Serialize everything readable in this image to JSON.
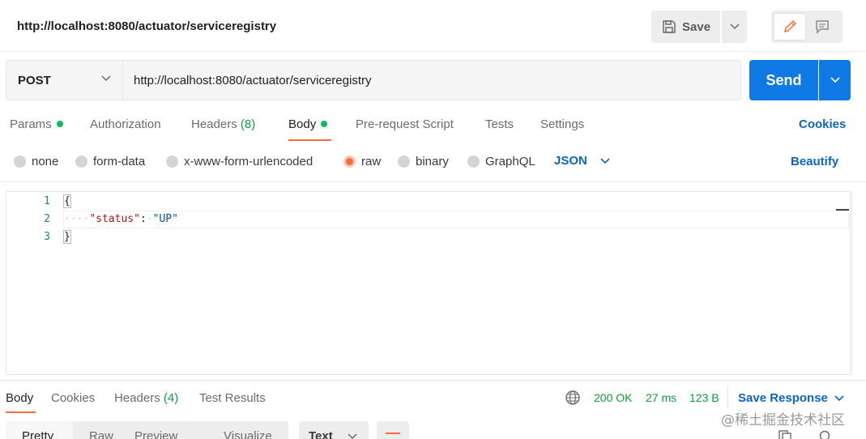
{
  "header": {
    "title": "http://localhost:8080/actuator/serviceregistry",
    "save_label": "Save"
  },
  "request": {
    "method": "POST",
    "url": "http://localhost:8080/actuator/serviceregistry",
    "send_label": "Send"
  },
  "request_tabs": {
    "params": "Params",
    "authorization": "Authorization",
    "headers": "Headers",
    "headers_count": "(8)",
    "body": "Body",
    "prerequest": "Pre-request Script",
    "tests": "Tests",
    "settings": "Settings",
    "cookies": "Cookies"
  },
  "body_types": {
    "none": "none",
    "form_data": "form-data",
    "urlencoded": "x-www-form-urlencoded",
    "raw": "raw",
    "binary": "binary",
    "graphql": "GraphQL",
    "selected": "raw",
    "format": "JSON",
    "beautify": "Beautify"
  },
  "editor": {
    "line_numbers": [
      "1",
      "2",
      "3"
    ],
    "line1": "{",
    "indent": "····",
    "key": "\"status\"",
    "colon": ":",
    "value": "\"UP\"",
    "line3": "}"
  },
  "response": {
    "tabs": {
      "body": "Body",
      "cookies": "Cookies",
      "headers": "Headers",
      "headers_count": "(4)",
      "test_results": "Test Results"
    },
    "status": "200 OK",
    "time": "27 ms",
    "size": "123 B",
    "save_response": "Save Response",
    "view_tabs": [
      "Pretty",
      "Raw",
      "Preview",
      "Visualize"
    ],
    "format": "Text"
  },
  "watermark": "@稀土掘金技术社区",
  "colors": {
    "accent": "#ff6c37",
    "primary": "#0f7ae5",
    "link": "#0b65c2",
    "success": "#0cbb52"
  }
}
